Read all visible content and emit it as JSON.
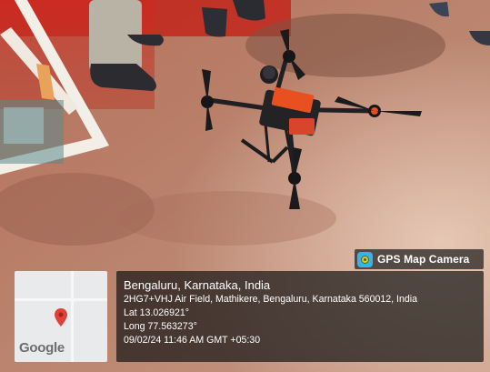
{
  "overlay": {
    "app_name": "GPS Map Camera",
    "app_icon": "gps-map-camera-app-icon",
    "map_brand": "Google",
    "location_title": "Bengaluru, Karnataka, India",
    "address": "2HG7+VHJ Air Field, Mathikere, Bengaluru, Karnataka 560012, India",
    "latitude": "Lat 13.026921°",
    "longitude": "Long 77.563273°",
    "timestamp": "09/02/24 11:46 AM GMT +05:30"
  },
  "colors": {
    "ground": "#b57a63",
    "pin": "#e0403a",
    "drone_accent": "#e8501f"
  }
}
